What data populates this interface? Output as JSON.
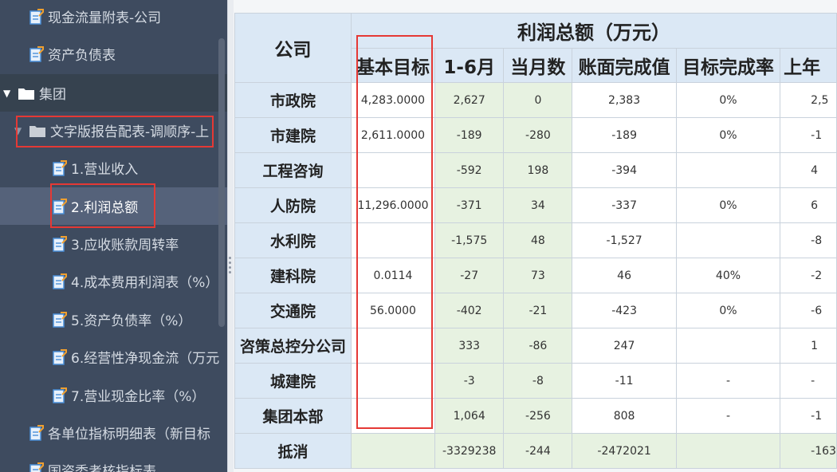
{
  "sidebar": {
    "items": [
      {
        "label": "现金流量附表-公司"
      },
      {
        "label": "资产负债表"
      },
      {
        "label": "集团"
      },
      {
        "label": "文字版报告配表-调顺序-上"
      },
      {
        "label": "1.营业收入"
      },
      {
        "label": "2.利润总额"
      },
      {
        "label": "3.应收账款周转率"
      },
      {
        "label": "4.成本费用利润表（%）"
      },
      {
        "label": "5.资产负债率（%）"
      },
      {
        "label": "6.经营性净现金流（万元"
      },
      {
        "label": "7.营业现金比率（%）"
      },
      {
        "label": "各单位指标明细表（新目标"
      },
      {
        "label": "国资委考核指标表"
      }
    ]
  },
  "table": {
    "group_header": "利润总额（万元）",
    "company_header": "公司",
    "columns": [
      "基本目标",
      "1-6月",
      "当月数",
      "账面完成值",
      "目标完成率",
      "上年"
    ],
    "rows": [
      {
        "company": "市政院",
        "cells": [
          "4,283.0000",
          "2,627",
          "0",
          "2,383",
          "0%",
          "2,5"
        ]
      },
      {
        "company": "市建院",
        "cells": [
          "2,611.0000",
          "-189",
          "-280",
          "-189",
          "0%",
          "-1"
        ]
      },
      {
        "company": "工程咨询",
        "cells": [
          "",
          "-592",
          "198",
          "-394",
          "",
          "4"
        ]
      },
      {
        "company": "人防院",
        "cells": [
          "11,296.0000",
          "-371",
          "34",
          "-337",
          "0%",
          "6"
        ]
      },
      {
        "company": "水利院",
        "cells": [
          "",
          "-1,575",
          "48",
          "-1,527",
          "",
          "-8"
        ]
      },
      {
        "company": "建科院",
        "cells": [
          "0.0114",
          "-27",
          "73",
          "46",
          "40%",
          "-2"
        ]
      },
      {
        "company": "交通院",
        "cells": [
          "56.0000",
          "-402",
          "-21",
          "-423",
          "0%",
          "-6"
        ]
      },
      {
        "company": "咨策总控分公司",
        "cells": [
          "",
          "333",
          "-86",
          "247",
          "",
          "1"
        ]
      },
      {
        "company": "城建院",
        "cells": [
          "",
          "-3",
          "-8",
          "-11",
          "-",
          "-"
        ]
      },
      {
        "company": "集团本部",
        "cells": [
          "",
          "1,064",
          "-256",
          "808",
          "-",
          "-1"
        ]
      },
      {
        "company": "抵消",
        "cells": [
          "",
          "-3329238",
          "-244",
          "-2472021",
          "",
          "-163"
        ]
      }
    ]
  },
  "colors": {
    "sidebar_bg": "#3e4b5f",
    "sidebar_selected": "#55627a",
    "header_bg": "#dbe8f5",
    "green_col_bg": "#e7f2e1",
    "highlight_red": "#e53935"
  }
}
